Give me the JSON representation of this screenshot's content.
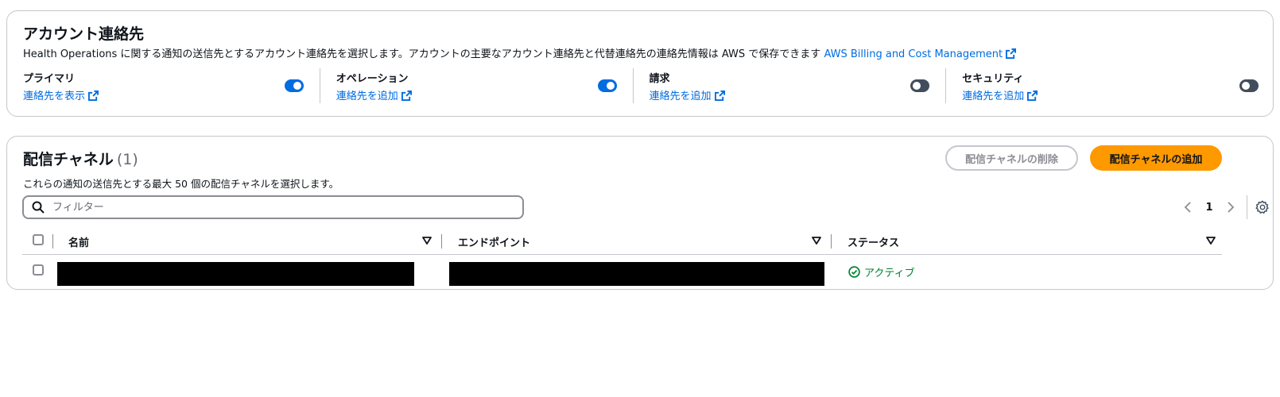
{
  "account_contacts": {
    "title": "アカウント連絡先",
    "description": "Health Operations に関する通知の送信先とするアカウント連絡先を選択します。アカウントの主要なアカウント連絡先と代替連絡先の連絡先情報は AWS で保存できます",
    "description_link": "AWS Billing and Cost Management",
    "contacts": [
      {
        "label": "プライマリ",
        "link": "連絡先を表示",
        "enabled": true
      },
      {
        "label": "オペレーション",
        "link": "連絡先を追加",
        "enabled": true
      },
      {
        "label": "請求",
        "link": "連絡先を追加",
        "enabled": false
      },
      {
        "label": "セキュリティ",
        "link": "連絡先を追加",
        "enabled": false
      }
    ]
  },
  "delivery_channels": {
    "title": "配信チャネル",
    "count": "(1)",
    "description": "これらの通知の送信先とする最大 50 個の配信チャネルを選択します。",
    "delete_button": "配信チャネルの削除",
    "add_button": "配信チャネルの追加",
    "filter_placeholder": "フィルター",
    "page": "1",
    "columns": [
      "名前",
      "エンドポイント",
      "ステータス"
    ],
    "rows": [
      {
        "status": "アクティブ"
      }
    ]
  },
  "colors": {
    "link": "#006ce0",
    "toggle_on": "#006ce0",
    "toggle_off": "#414d5c",
    "primary_button": "#ff9900",
    "status_active": "#00802f"
  }
}
